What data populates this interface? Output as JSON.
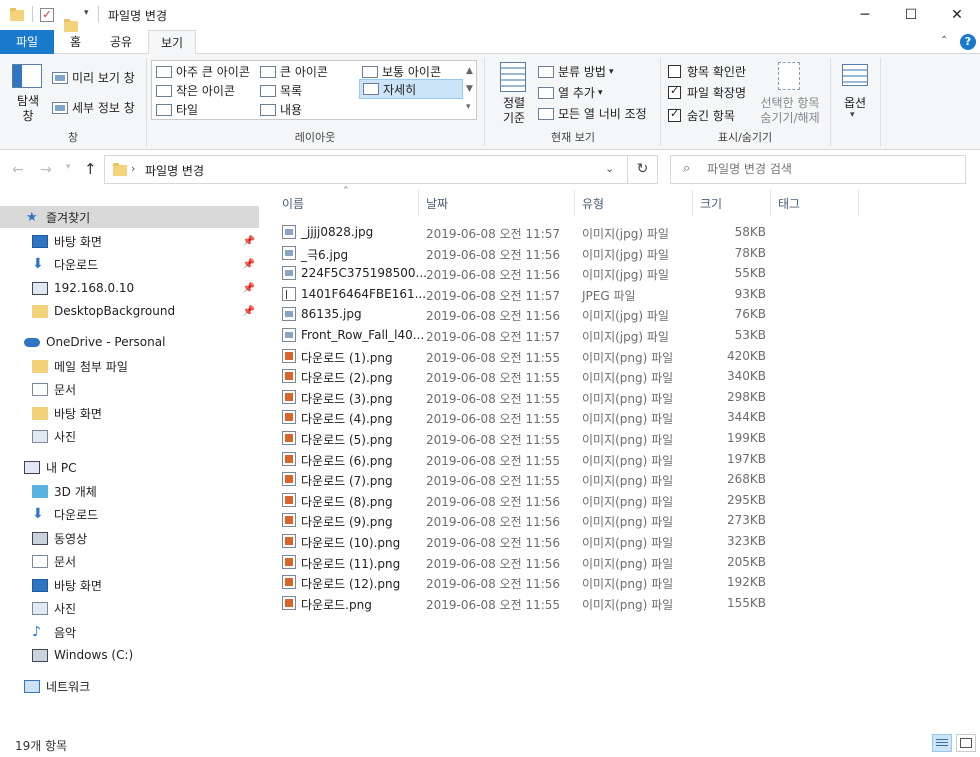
{
  "window": {
    "title": "파일명 변경"
  },
  "tabs": [
    {
      "label": "파일"
    },
    {
      "label": "홈"
    },
    {
      "label": "공유"
    },
    {
      "label": "보기"
    }
  ],
  "ribbon": {
    "pane": {
      "nav_pane": "탐색\n창",
      "preview": "미리 보기 창",
      "details": "세부 정보 창",
      "group": "창"
    },
    "layout": {
      "items": [
        "아주 큰 아이콘",
        "큰 아이콘",
        "보통 아이콘",
        "작은 아이콘",
        "목록",
        "자세히",
        "타일",
        "내용"
      ],
      "selected": "자세히",
      "group": "레이아웃"
    },
    "current_view": {
      "sort": "정렬\n기준",
      "group_by": "분류 방법",
      "add_column": "열 추가",
      "fit_columns": "모든 열 너비 조정",
      "group": "현재 보기"
    },
    "show_hide": {
      "item_checkbox": "항목 확인란",
      "extensions": "파일 확장명",
      "hidden": "숨긴 항목",
      "hide_selected": "선택한 항목\n숨기기/해제",
      "group": "표시/숨기기"
    },
    "options": "옵션"
  },
  "address": {
    "path": "파일명 변경",
    "search_placeholder": "파일명 변경 검색"
  },
  "nav": {
    "quick_access": "즐겨찾기",
    "quick_items": [
      "바탕 화면",
      "다운로드",
      "192.168.0.10",
      "DesktopBackground"
    ],
    "onedrive": "OneDrive - Personal",
    "onedrive_items": [
      "메일 첨부 파일",
      "문서",
      "바탕 화면",
      "사진"
    ],
    "this_pc": "내 PC",
    "pc_items": [
      "3D 개체",
      "다운로드",
      "동영상",
      "문서",
      "바탕 화면",
      "사진",
      "음악",
      "Windows (C:)"
    ],
    "network": "네트워크"
  },
  "columns": {
    "name": "이름",
    "date": "날짜",
    "type": "유형",
    "size": "크기",
    "tags": "태그"
  },
  "files": [
    {
      "name": "_jjjj0828.jpg",
      "date": "2019-06-08 오전 11:57",
      "type": "이미지(jpg) 파일",
      "size": "58KB",
      "icon": "jpg"
    },
    {
      "name": "_극6.jpg",
      "date": "2019-06-08 오전 11:56",
      "type": "이미지(jpg) 파일",
      "size": "78KB",
      "icon": "jpg"
    },
    {
      "name": "224F5C375198500...",
      "date": "2019-06-08 오전 11:56",
      "type": "이미지(jpg) 파일",
      "size": "55KB",
      "icon": "jpg"
    },
    {
      "name": "1401F6464FBE161...",
      "date": "2019-06-08 오전 11:57",
      "type": "JPEG 파일",
      "size": "93KB",
      "icon": "jpeg"
    },
    {
      "name": "86135.jpg",
      "date": "2019-06-08 오전 11:56",
      "type": "이미지(jpg) 파일",
      "size": "76KB",
      "icon": "jpg"
    },
    {
      "name": "Front_Row_Fall_l40...",
      "date": "2019-06-08 오전 11:57",
      "type": "이미지(jpg) 파일",
      "size": "53KB",
      "icon": "jpg"
    },
    {
      "name": "다운로드 (1).png",
      "date": "2019-06-08 오전 11:55",
      "type": "이미지(png) 파일",
      "size": "420KB",
      "icon": "png"
    },
    {
      "name": "다운로드 (2).png",
      "date": "2019-06-08 오전 11:55",
      "type": "이미지(png) 파일",
      "size": "340KB",
      "icon": "png"
    },
    {
      "name": "다운로드 (3).png",
      "date": "2019-06-08 오전 11:55",
      "type": "이미지(png) 파일",
      "size": "298KB",
      "icon": "png"
    },
    {
      "name": "다운로드 (4).png",
      "date": "2019-06-08 오전 11:55",
      "type": "이미지(png) 파일",
      "size": "344KB",
      "icon": "png"
    },
    {
      "name": "다운로드 (5).png",
      "date": "2019-06-08 오전 11:55",
      "type": "이미지(png) 파일",
      "size": "199KB",
      "icon": "png"
    },
    {
      "name": "다운로드 (6).png",
      "date": "2019-06-08 오전 11:55",
      "type": "이미지(png) 파일",
      "size": "197KB",
      "icon": "png"
    },
    {
      "name": "다운로드 (7).png",
      "date": "2019-06-08 오전 11:55",
      "type": "이미지(png) 파일",
      "size": "268KB",
      "icon": "png"
    },
    {
      "name": "다운로드 (8).png",
      "date": "2019-06-08 오전 11:56",
      "type": "이미지(png) 파일",
      "size": "295KB",
      "icon": "png"
    },
    {
      "name": "다운로드 (9).png",
      "date": "2019-06-08 오전 11:56",
      "type": "이미지(png) 파일",
      "size": "273KB",
      "icon": "png"
    },
    {
      "name": "다운로드 (10).png",
      "date": "2019-06-08 오전 11:56",
      "type": "이미지(png) 파일",
      "size": "323KB",
      "icon": "png"
    },
    {
      "name": "다운로드 (11).png",
      "date": "2019-06-08 오전 11:56",
      "type": "이미지(png) 파일",
      "size": "205KB",
      "icon": "png"
    },
    {
      "name": "다운로드 (12).png",
      "date": "2019-06-08 오전 11:56",
      "type": "이미지(png) 파일",
      "size": "192KB",
      "icon": "png"
    },
    {
      "name": "다운로드.png",
      "date": "2019-06-08 오전 11:55",
      "type": "이미지(png) 파일",
      "size": "155KB",
      "icon": "png"
    }
  ],
  "status": {
    "count": "19개 항목"
  },
  "colors": {
    "accent": "#1979ca",
    "selection": "#cce4f7",
    "folder": "#f3d37a",
    "png_icon": "#d9652b"
  }
}
